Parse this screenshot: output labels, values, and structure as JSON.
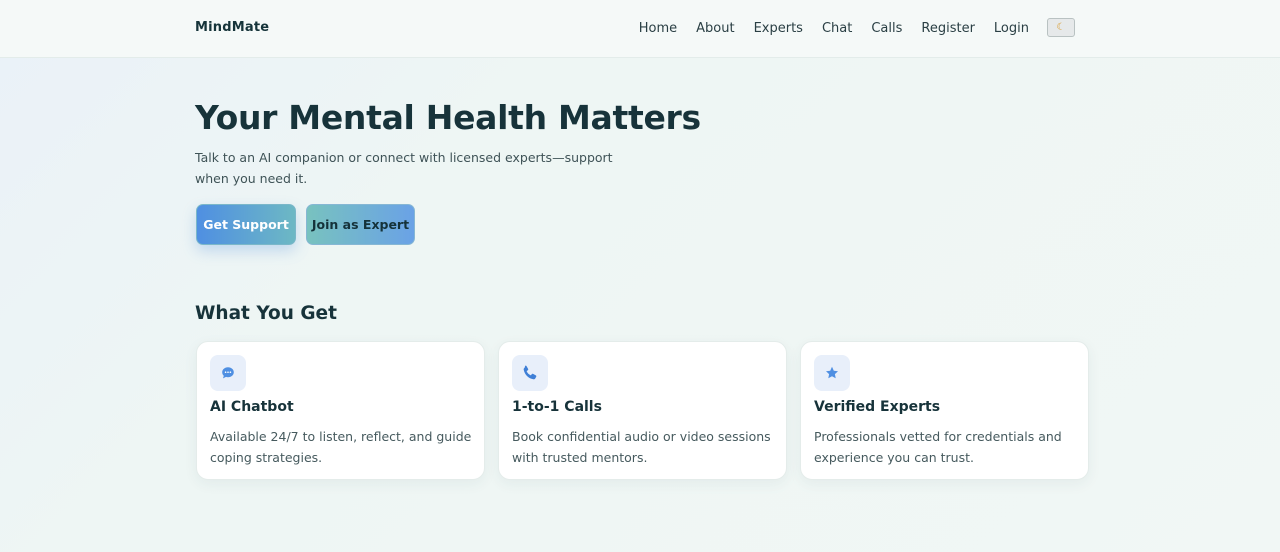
{
  "brand": "MindMate",
  "nav": {
    "items": [
      "Home",
      "About",
      "Experts",
      "Chat",
      "Calls",
      "Register",
      "Login"
    ],
    "theme_toggle_icon": "moon-icon"
  },
  "hero": {
    "title": "Your Mental Health Matters",
    "subtitle": "Talk to an AI companion or connect with licensed experts—support when you need it.",
    "primary_button": "Get Support",
    "secondary_button": "Join as Expert"
  },
  "features": {
    "title": "What You Get",
    "cards": [
      {
        "icon": "chat-bubble-icon",
        "title": "AI Chatbot",
        "description": "Available 24/7 to listen, reflect, and guide coping strategies."
      },
      {
        "icon": "phone-icon",
        "title": "1-to-1 Calls",
        "description": "Book confidential audio or video sessions with trusted mentors."
      },
      {
        "icon": "star-icon",
        "title": "Verified Experts",
        "description": "Professionals vetted for credentials and experience you can trust."
      }
    ]
  },
  "colors": {
    "accent_blue": "#4f8fe2",
    "accent_teal": "#6db8c4",
    "heading": "#17333a"
  }
}
